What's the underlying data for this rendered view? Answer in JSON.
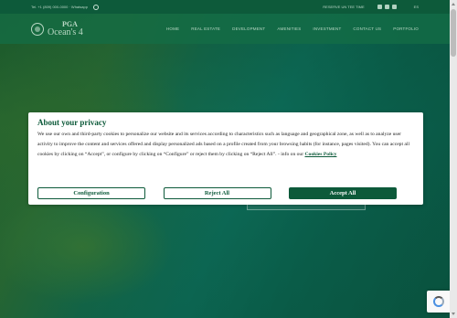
{
  "topbar": {
    "phone": "Tel. +1 (809) 000-0000 · Whatsapp",
    "booking": "RESERVE UN TEE TIME",
    "social_icons": [
      "facebook-icon",
      "instagram-icon",
      "youtube-icon"
    ],
    "language": "ES"
  },
  "header": {
    "logo_pga": "PGA",
    "logo_name": "Ocean's 4",
    "nav": [
      "HOME",
      "REAL ESTATE",
      "DEVELOPMENT",
      "AMENITIES",
      "INVESTMENT",
      "CONTACT US",
      "PORTFOLIO"
    ]
  },
  "privacy_modal": {
    "title": "About your privacy",
    "body_text": "We use our own and third-party cookies to personalize our website and its services according to characteristics such as language and geographical zone, as well as to analyze user activity to improve the content and services offered and display personalized ads based on a profile created from your browsing habits (for instance, pages visited). You can accept all cookies by clicking on “Accept”, or configure by clicking on “Configure” or reject them by clicking on “Reject All”. - info on our ",
    "policy_link": "Cookies Policy",
    "buttons": {
      "configuration": "Configuration",
      "reject": "Reject All",
      "accept": "Accept All"
    }
  },
  "colors": {
    "brand_green": "#0d5a3a",
    "modal_bg": "#ffffff"
  }
}
